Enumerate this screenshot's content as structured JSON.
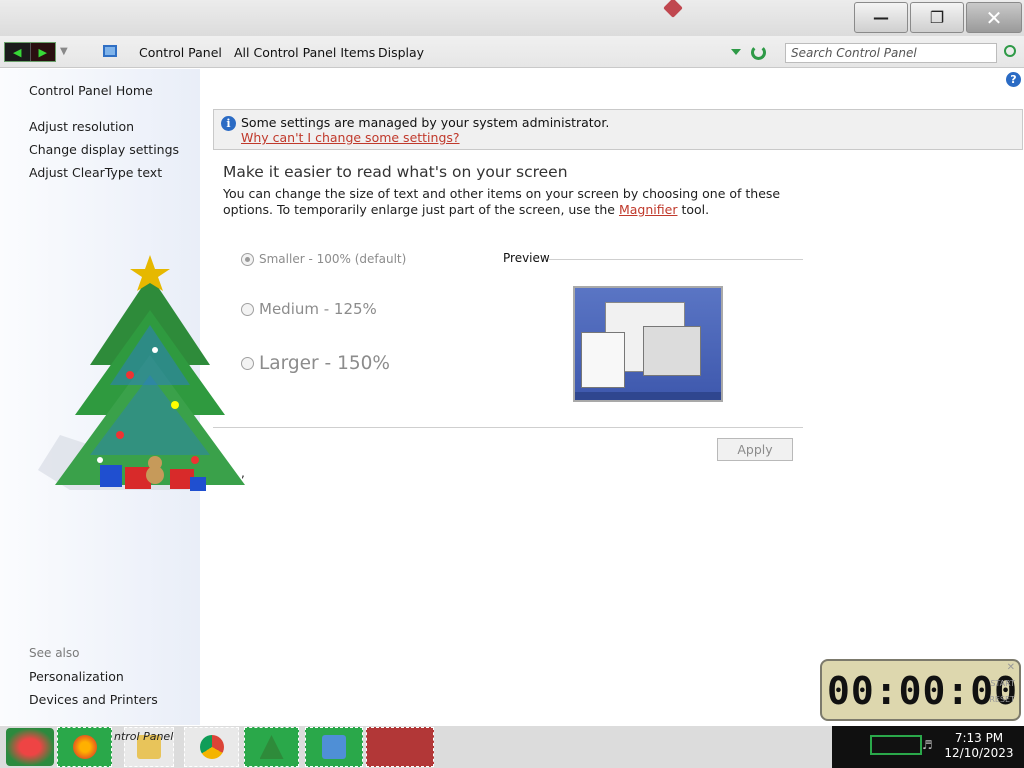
{
  "window": {
    "minimize_icon": "minimize-icon",
    "maximize_icon": "restore-icon",
    "close_icon": "close-icon"
  },
  "address": {
    "breadcrumbs": [
      "Control Panel",
      "All Control Panel Items",
      "Display"
    ],
    "search_placeholder": "Search Control Panel"
  },
  "left_pane": {
    "home_link": "Control Panel Home",
    "tasks": [
      "Adjust resolution",
      "Change display settings",
      "Adjust ClearType text"
    ],
    "see_also_label": "See also",
    "see_also": [
      "Personalization",
      "Devices and Printers"
    ]
  },
  "info_bar": {
    "message": "Some settings are managed by your system administrator.",
    "link": "Why can't I change some settings?"
  },
  "main": {
    "heading": "Make it easier to read what's on your screen",
    "description_before": "You can change the size of text and other items on your screen by choosing one of these options. To temporarily enlarge just part of the screen, use the ",
    "magnifier_link": "Magnifier",
    "description_after": " tool.",
    "options": [
      {
        "label": "Smaller - 100% (default)",
        "checked": true
      },
      {
        "label": "Medium - 125%",
        "checked": false
      },
      {
        "label": "Larger - 150%",
        "checked": false
      }
    ],
    "preview_label": "Preview",
    "apply_label": "Apply",
    "stray_mark": ","
  },
  "stopwatch": {
    "time": "00:00:00",
    "start_label": "START",
    "reset_label": "RESET"
  },
  "taskbar": {
    "partial_label": "ntrol Panel",
    "clock_time": "7:13 PM",
    "clock_date": "12/10/2023"
  },
  "colors": {
    "accent_link": "#c0392b",
    "taskbar_green": "#2aa84a",
    "taskbar_red": "#b23737"
  }
}
